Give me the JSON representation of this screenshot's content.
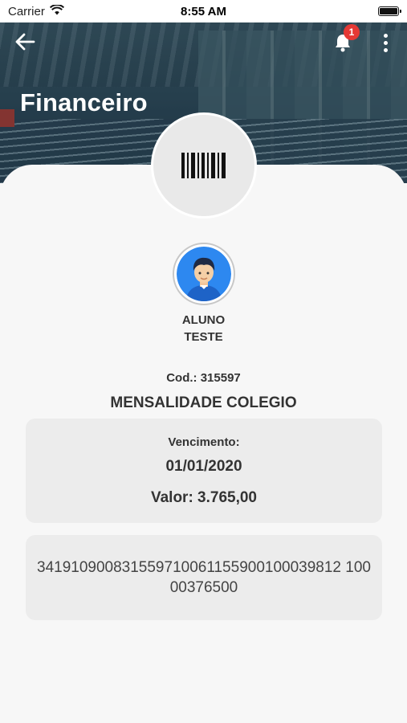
{
  "status_bar": {
    "carrier": "Carrier",
    "time": "8:55 AM"
  },
  "header": {
    "title": "Financeiro",
    "notification_count": "1"
  },
  "student": {
    "name_line1": "ALUNO",
    "name_line2": "TESTE"
  },
  "invoice": {
    "code": "Cod.: 315597",
    "description": "MENSALIDADE COLEGIO",
    "due_label": "Vencimento:",
    "due_date": "01/01/2020",
    "value": "Valor: 3.765,00",
    "digitable_line": "341910900831559710061155900100039812 10000376500"
  },
  "colors": {
    "accent": "#2196f3",
    "badge": "#e53935",
    "box": "#ececec"
  },
  "icons": [
    "back-arrow-icon",
    "bell-icon",
    "more-vertical-icon",
    "barcode-icon",
    "avatar-icon",
    "wifi-icon",
    "battery-icon"
  ]
}
